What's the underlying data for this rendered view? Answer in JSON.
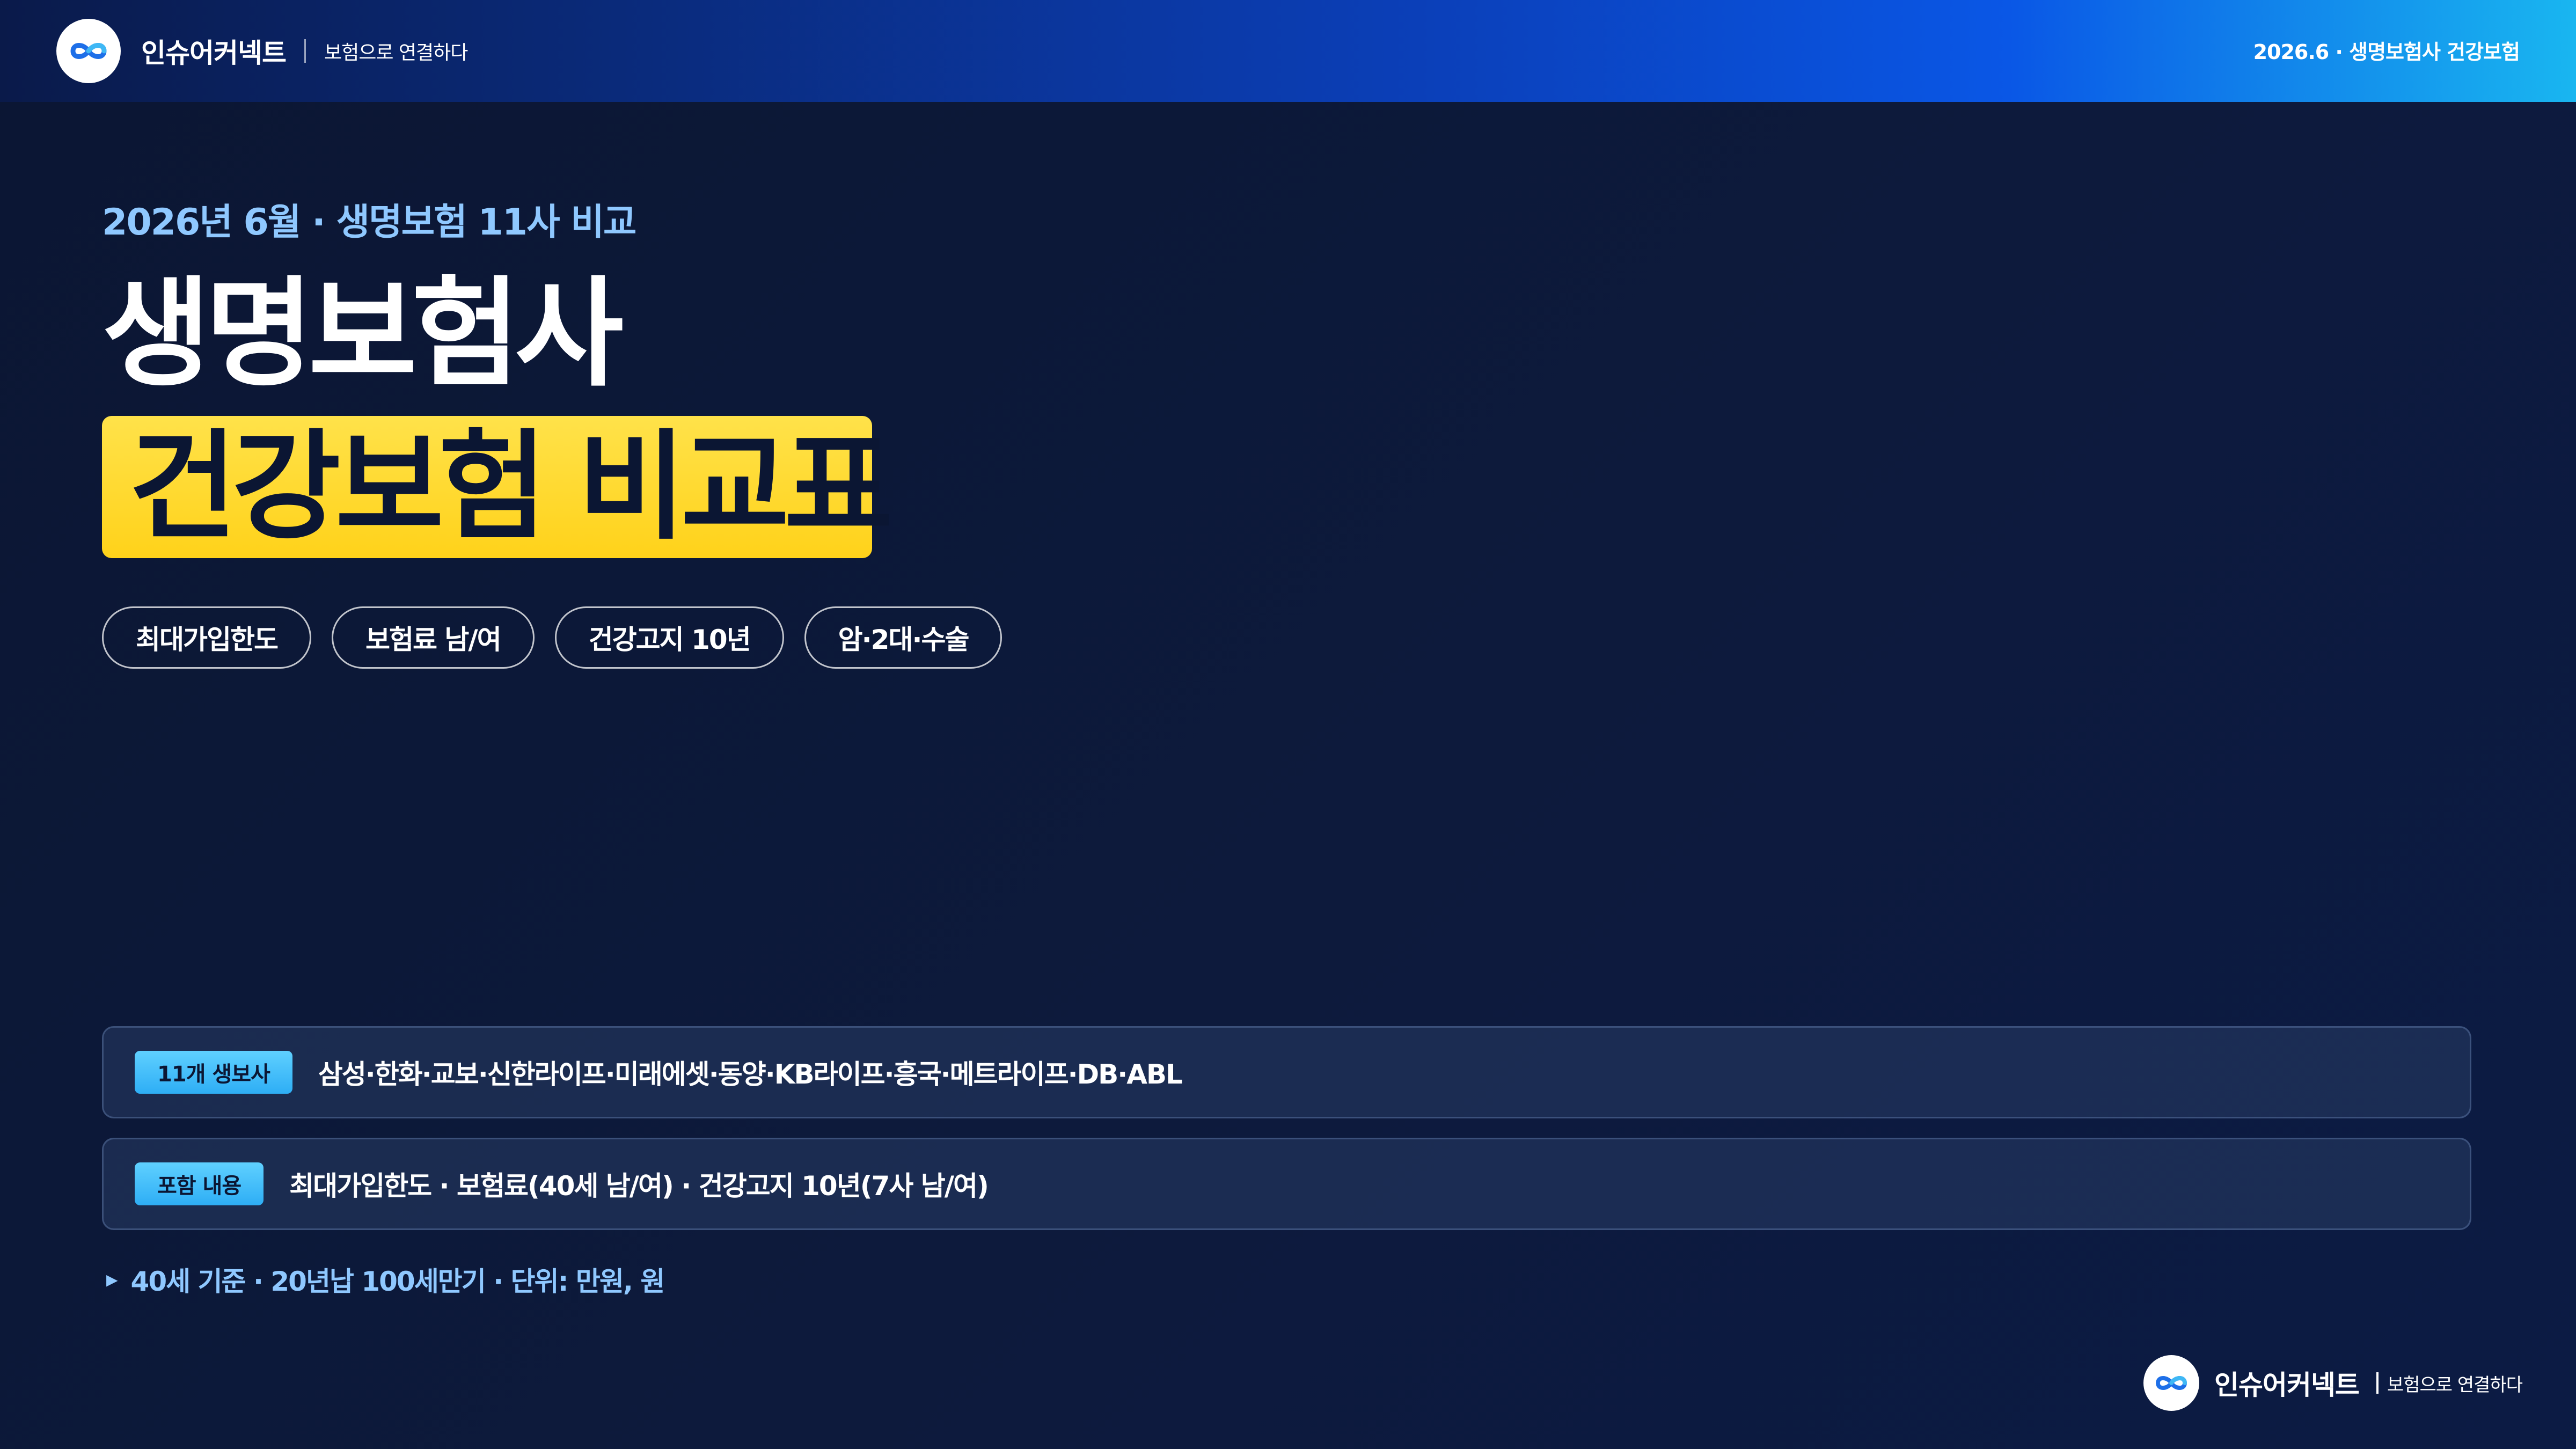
{
  "header": {
    "brand_name": "인슈어커넥트",
    "brand_tagline": "보험으로 연결하다",
    "right_label": "2026.6 · 생명보험사 건강보험",
    "logo_icon": "infinity-icon"
  },
  "hero": {
    "eyebrow": "2026년 6월 · 생명보험 11사 비교",
    "title_line1": "생명보험사",
    "title_line2": "건강보험 비교표",
    "highlight_color": "#FFD21A"
  },
  "chips": [
    "최대가입한도",
    "보험료 남/여",
    "건강고지 10년",
    "암·2대·수술"
  ],
  "info_rows": [
    {
      "badge": "11개 생보사",
      "text": "삼성·한화·교보·신한라이프·미래에셋·동양·KB라이프·흥국·메트라이프·DB·ABL"
    },
    {
      "badge": "포함 내용",
      "text": "최대가입한도 · 보험료(40세 남/여) · 건강고지 10년(7사 남/여)"
    }
  ],
  "footnote": {
    "text": "40세 기준 · 20년납 100세만기 · 단위: 만원, 원",
    "icon": "triangle-right-icon"
  },
  "footer": {
    "brand_name": "인슈어커넥트",
    "brand_tagline": "보험으로 연결하다"
  },
  "colors": {
    "background": "#0B1633",
    "accent_blue": "#8FC8FF",
    "badge": "#2EAEF5",
    "highlight": "#FFD21A"
  }
}
